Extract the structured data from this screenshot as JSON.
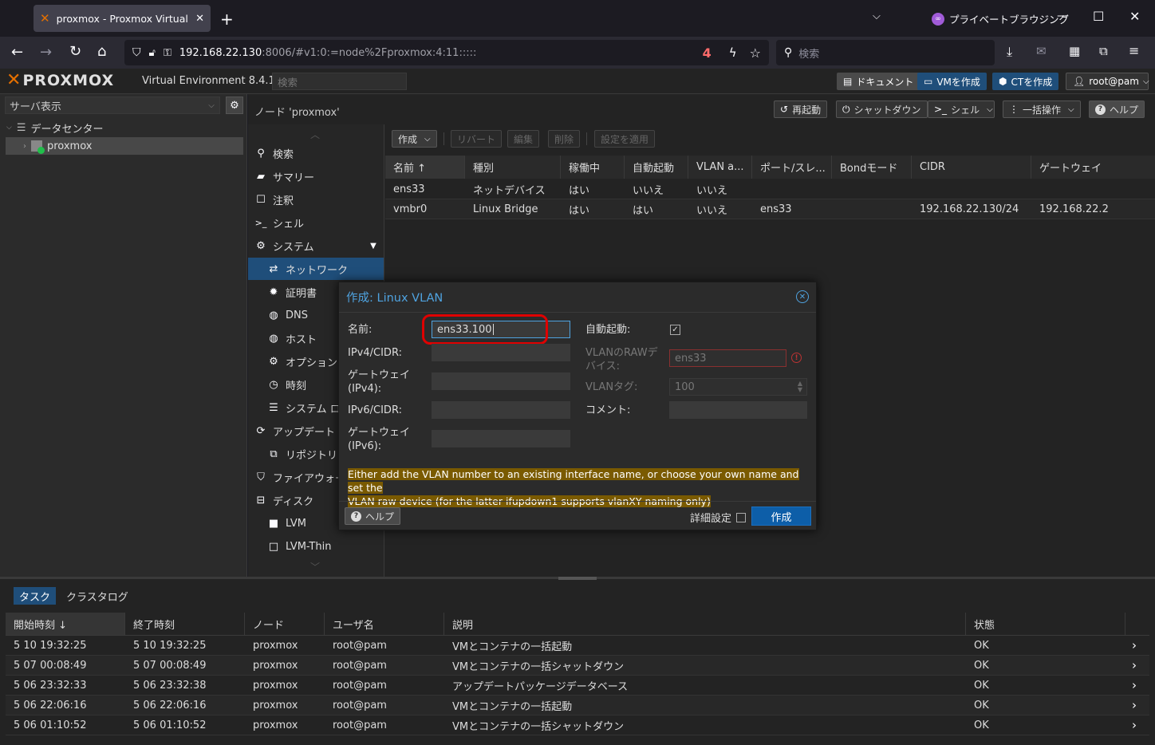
{
  "browser": {
    "tab_title": "proxmox - Proxmox Virtual Envi",
    "private_label": "プライベートブラウジング",
    "url_host": "192.168.22.130",
    "url_rest": ":8006/#v1:0:=node%2Fproxmox:4:11:::::",
    "badge_count": "4",
    "search_placeholder": "検索"
  },
  "pve": {
    "logo": "PROXMOX",
    "version": "Virtual Environment 8.4.1",
    "search_placeholder": "検索",
    "buttons": {
      "docs": "ドキュメント",
      "create_vm": "VMを作成",
      "create_ct": "CTを作成",
      "user": "root@pam"
    }
  },
  "left": {
    "view": "サーバ表示",
    "datacenter": "データセンター",
    "node": "proxmox"
  },
  "node": {
    "title": "ノード 'proxmox'",
    "buttons": {
      "reboot": "再起動",
      "shutdown": "シャットダウン",
      "shell": "シェル",
      "bulk": "一括操作",
      "help": "ヘルプ"
    },
    "menu": [
      {
        "label": "検索",
        "icon": "search-icon"
      },
      {
        "label": "サマリー",
        "icon": "book-icon"
      },
      {
        "label": "注釈",
        "icon": "note-icon"
      },
      {
        "label": "シェル",
        "icon": "terminal-icon"
      },
      {
        "label": "システム",
        "icon": "gears-icon"
      },
      {
        "label": "ネットワーク",
        "icon": "exchange-icon"
      },
      {
        "label": "証明書",
        "icon": "certificate-icon"
      },
      {
        "label": "DNS",
        "icon": "globe-icon"
      },
      {
        "label": "ホスト",
        "icon": "globe-icon"
      },
      {
        "label": "オプション",
        "icon": "gear-icon"
      },
      {
        "label": "時刻",
        "icon": "clock-icon"
      },
      {
        "label": "システム ロ",
        "icon": "list-icon"
      },
      {
        "label": "アップデート",
        "icon": "refresh-icon"
      },
      {
        "label": "リポジトリ",
        "icon": "files-icon"
      },
      {
        "label": "ファイアウォー",
        "icon": "shield-icon"
      },
      {
        "label": "ディスク",
        "icon": "hdd-icon"
      },
      {
        "label": "LVM",
        "icon": "square-icon"
      },
      {
        "label": "LVM-Thin",
        "icon": "square-outline-icon"
      }
    ]
  },
  "network": {
    "toolbar": {
      "create": "作成",
      "revert": "リバート",
      "edit": "編集",
      "delete": "削除",
      "apply": "設定を適用"
    },
    "columns": [
      "名前 ↑",
      "種別",
      "稼働中",
      "自動起動",
      "VLAN a...",
      "ポート/スレ...",
      "Bondモード",
      "CIDR",
      "ゲートウェイ"
    ],
    "rows": [
      [
        "ens33",
        "ネットデバイス",
        "はい",
        "いいえ",
        "いいえ",
        "",
        "",
        "",
        ""
      ],
      [
        "vmbr0",
        "Linux Bridge",
        "はい",
        "はい",
        "いいえ",
        "ens33",
        "",
        "192.168.22.130/24",
        "192.168.22.2"
      ]
    ]
  },
  "dialog": {
    "title": "作成: Linux VLAN",
    "labels": {
      "name": "名前:",
      "ipv4": "IPv4/CIDR:",
      "gw4_a": "ゲートウェイ",
      "gw4_b": "(IPv4):",
      "ipv6": "IPv6/CIDR:",
      "gw6_a": "ゲートウェイ",
      "gw6_b": "(IPv6):",
      "autostart": "自動起動:",
      "raw_a": "VLANのRAWデ",
      "raw_b": "バイス:",
      "tag": "VLANタグ:",
      "comment": "コメント:"
    },
    "values": {
      "name": "ens33.100",
      "raw_device": "ens33",
      "vlan_tag": "100"
    },
    "warning_1": "Either add the VLAN number to an existing interface name, or choose your own name and set the",
    "warning_2": "VLAN raw device (for the latter ifupdown1 supports vlanXY naming only)",
    "help": "ヘルプ",
    "advanced": "詳細設定",
    "create": "作成"
  },
  "tasks": {
    "tabs": [
      "タスク",
      "クラスタログ"
    ],
    "columns": [
      "開始時刻 ↓",
      "終了時刻",
      "ノード",
      "ユーザ名",
      "説明",
      "状態"
    ],
    "rows": [
      [
        "5 10 19:32:25",
        "5 10 19:32:25",
        "proxmox",
        "root@pam",
        "VMとコンテナの一括起動",
        "OK"
      ],
      [
        "5 07 00:08:49",
        "5 07 00:08:49",
        "proxmox",
        "root@pam",
        "VMとコンテナの一括シャットダウン",
        "OK"
      ],
      [
        "5 06 23:32:33",
        "5 06 23:32:38",
        "proxmox",
        "root@pam",
        "アップデートパッケージデータベース",
        "OK"
      ],
      [
        "5 06 22:06:16",
        "5 06 22:06:16",
        "proxmox",
        "root@pam",
        "VMとコンテナの一括起動",
        "OK"
      ],
      [
        "5 06 01:10:52",
        "5 06 01:10:52",
        "proxmox",
        "root@pam",
        "VMとコンテナの一括シャットダウン",
        "OK"
      ]
    ]
  },
  "colors": {
    "accent_blue": "#1f4e7a",
    "highlight_red": "#e00000",
    "warning_bg": "#7a5a00"
  }
}
